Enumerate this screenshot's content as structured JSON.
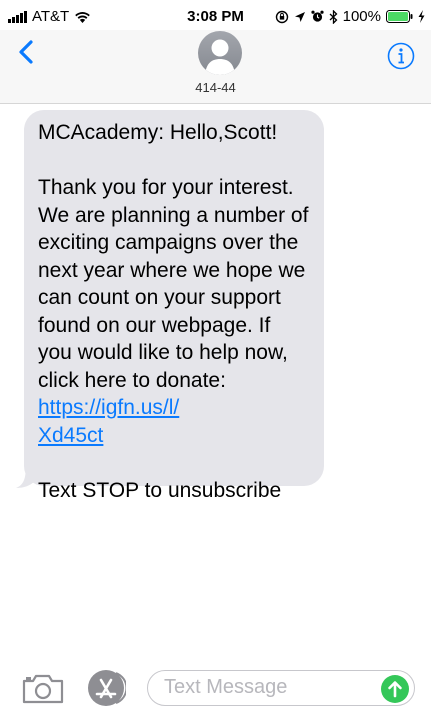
{
  "status_bar": {
    "carrier": "AT&T",
    "time": "3:08 PM",
    "battery": "100%"
  },
  "header": {
    "contact": "414-44"
  },
  "message": {
    "greeting": "MCAcademy: Hello,Scott!",
    "body": "Thank you for your interest. We are planning a number of exciting campaigns over the next year where we hope we can count on your support found on our webpage. If you would like to help now, click here to donate:",
    "link_line1": "https://igfn.us/l/",
    "link_line2": "Xd45ct",
    "footer": "Text STOP to unsubscribe"
  },
  "compose": {
    "placeholder": "Text Message"
  },
  "colors": {
    "accent": "#0a7afe",
    "bubble": "#e5e5ea",
    "send": "#34c759",
    "battery": "#4cd964"
  },
  "icons": [
    "signal-icon",
    "wifi-icon",
    "rotation-lock-icon",
    "location-icon",
    "alarm-icon",
    "bluetooth-icon",
    "battery-icon",
    "charging-icon",
    "back-chevron-icon",
    "avatar-icon",
    "info-icon",
    "camera-icon",
    "app-store-icon",
    "send-arrow-icon"
  ]
}
